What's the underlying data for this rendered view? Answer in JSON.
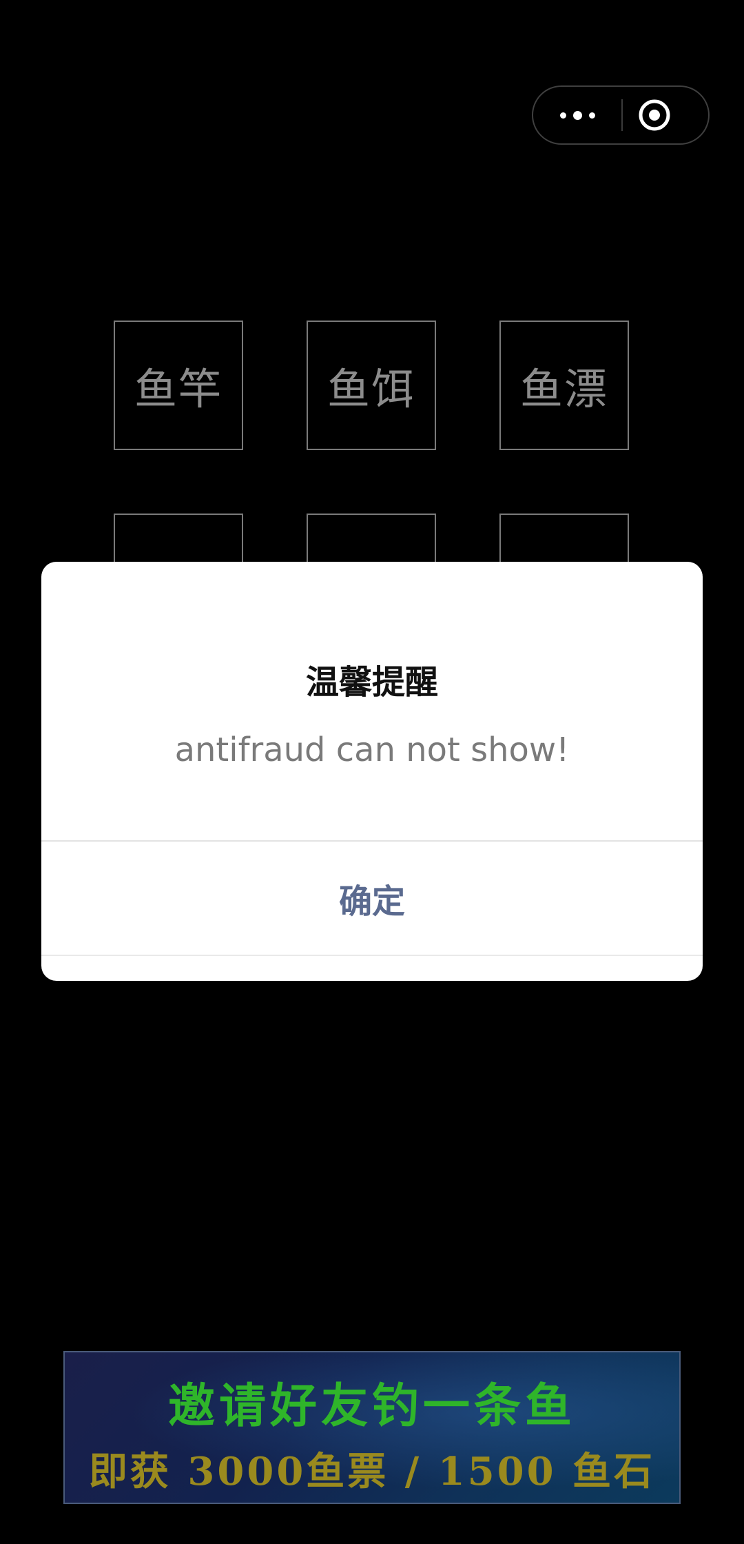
{
  "capsule": {
    "more_icon": "more-dots-icon",
    "close_icon": "target-icon"
  },
  "grid": {
    "row1": [
      "鱼竿",
      "鱼饵",
      "鱼漂"
    ],
    "row2_partial": [
      "",
      "",
      ""
    ]
  },
  "dialog": {
    "title": "温馨提醒",
    "message": "antifraud can not show!",
    "confirm_label": "确定"
  },
  "banner": {
    "line1": "邀请好友钓一条鱼",
    "line2": "即获 3000鱼票 / 1500 鱼石"
  }
}
